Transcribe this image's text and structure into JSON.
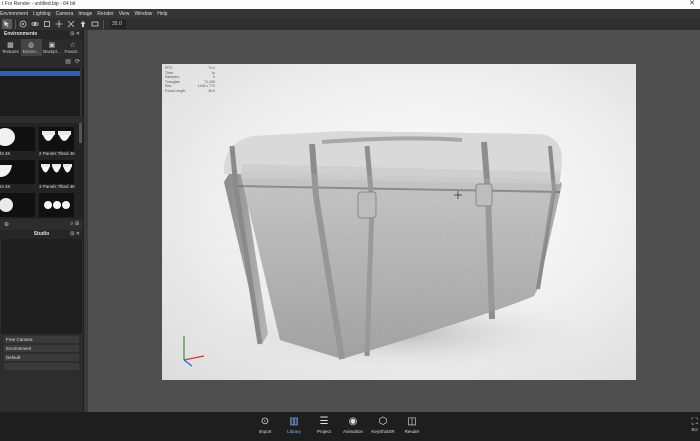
{
  "window": {
    "title": "t For Render - untitled.bip - 64 bit",
    "close_glyph": "✕"
  },
  "menu": [
    "Environment",
    "Lighting",
    "Camera",
    "Image",
    "Render",
    "View",
    "Window",
    "Help"
  ],
  "toolbar": {
    "buttons": [
      "select-icon",
      "pan-icon",
      "orbit-icon",
      "zoom-icon",
      "move-icon",
      "scale-icon",
      "up-arrow-icon",
      "fit-icon"
    ],
    "field_value": "35.0"
  },
  "left_panel": {
    "title": "Environments",
    "tabs": [
      {
        "label": "Textures",
        "icon": "texture-icon"
      },
      {
        "label": "Enviro...",
        "icon": "environment-icon"
      },
      {
        "label": "Backpl...",
        "icon": "backplate-icon"
      },
      {
        "label": "Favori...",
        "icon": "star-icon"
      }
    ],
    "thumbnails": [
      {
        "caption": "ht 4K"
      },
      {
        "caption": "2 Panels Tilted 4K"
      },
      {
        "caption": "nt 4K"
      },
      {
        "caption": "3 Panels Tilted 4K"
      },
      {
        "caption": ""
      },
      {
        "caption": ""
      }
    ]
  },
  "studio": {
    "title": "Studio",
    "items": [
      "Free Camera",
      "Environment",
      "Default",
      ""
    ]
  },
  "viewport": {
    "stats": [
      {
        "k": "FPS:",
        "v": "70.4"
      },
      {
        "k": "Time:",
        "v": "1s"
      },
      {
        "k": "Samples:",
        "v": "9"
      },
      {
        "k": "Triangles:",
        "v": "71,205"
      },
      {
        "k": "Res:",
        "v": "1448 x 772"
      },
      {
        "k": "Focal Length:",
        "v": "35.0"
      }
    ]
  },
  "bottom_bar": {
    "buttons": [
      {
        "label": "Import",
        "icon": "import-icon"
      },
      {
        "label": "Library",
        "icon": "library-icon",
        "active": true
      },
      {
        "label": "Project",
        "icon": "project-icon"
      },
      {
        "label": "Animation",
        "icon": "animation-icon"
      },
      {
        "label": "KeyShotXR",
        "icon": "keyshotxr-icon"
      },
      {
        "label": "Render",
        "icon": "render-icon"
      }
    ],
    "right_label": "Scr"
  },
  "colors": {
    "accent": "#2f5fb5",
    "active_tab": "#7fb7ff"
  }
}
